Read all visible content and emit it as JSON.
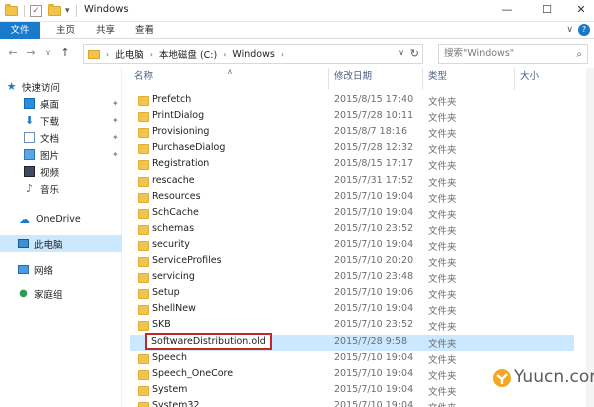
{
  "window": {
    "title": "Windows",
    "qa_dropdown": "▾",
    "controls": {
      "minimize": "—",
      "maximize": "☐",
      "close": "✕"
    }
  },
  "ribbon": {
    "tabs": [
      "文件",
      "主页",
      "共享",
      "查看"
    ],
    "expand": "∨",
    "help": "?",
    "file_color": "#1979ca"
  },
  "nav": {
    "back": "←",
    "forward": "→",
    "recent": "∨",
    "up": "↑",
    "breadcrumb": [
      "此电脑",
      "本地磁盘 (C:)",
      "Windows"
    ],
    "breadcrumb_sep": "›",
    "dropdown": "∨",
    "refresh": "↻",
    "search_placeholder": "搜索\"Windows\"",
    "search_icon": "⌕"
  },
  "sidebar": {
    "items": [
      {
        "label": "快速访问",
        "icon": "star-icon",
        "glyph": "★"
      },
      {
        "label": "桌面",
        "icon": "desktop-icon",
        "pinned": true
      },
      {
        "label": "下载",
        "icon": "download-icon",
        "pinned": true
      },
      {
        "label": "文档",
        "icon": "documents-icon",
        "pinned": true
      },
      {
        "label": "图片",
        "icon": "pictures-icon",
        "pinned": true
      },
      {
        "label": "视频",
        "icon": "videos-icon"
      },
      {
        "label": "音乐",
        "icon": "music-icon"
      },
      {
        "label": "OneDrive",
        "icon": "onedrive-icon"
      },
      {
        "label": "此电脑",
        "icon": "this-pc-icon",
        "selected": true
      },
      {
        "label": "网络",
        "icon": "network-icon"
      },
      {
        "label": "家庭组",
        "icon": "homegroup-icon"
      }
    ],
    "pin_glyph": "✦",
    "selected_color": "#cce8ff"
  },
  "columns": {
    "name": "名称",
    "date": "修改日期",
    "type": "类型",
    "size": "大小",
    "sort_indicator": "∧"
  },
  "files": [
    {
      "name": "Prefetch",
      "date": "2015/8/15 17:40",
      "type": "文件夹"
    },
    {
      "name": "PrintDialog",
      "date": "2015/7/28 10:11",
      "type": "文件夹"
    },
    {
      "name": "Provisioning",
      "date": "2015/8/7 18:16",
      "type": "文件夹"
    },
    {
      "name": "PurchaseDialog",
      "date": "2015/7/28 12:32",
      "type": "文件夹"
    },
    {
      "name": "Registration",
      "date": "2015/8/15 17:17",
      "type": "文件夹"
    },
    {
      "name": "rescache",
      "date": "2015/7/31 17:52",
      "type": "文件夹"
    },
    {
      "name": "Resources",
      "date": "2015/7/10 19:04",
      "type": "文件夹"
    },
    {
      "name": "SchCache",
      "date": "2015/7/10 19:04",
      "type": "文件夹"
    },
    {
      "name": "schemas",
      "date": "2015/7/10 23:52",
      "type": "文件夹"
    },
    {
      "name": "security",
      "date": "2015/7/10 19:04",
      "type": "文件夹"
    },
    {
      "name": "ServiceProfiles",
      "date": "2015/7/10 20:20",
      "type": "文件夹"
    },
    {
      "name": "servicing",
      "date": "2015/7/10 23:48",
      "type": "文件夹"
    },
    {
      "name": "Setup",
      "date": "2015/7/10 19:06",
      "type": "文件夹"
    },
    {
      "name": "ShellNew",
      "date": "2015/7/10 19:04",
      "type": "文件夹"
    },
    {
      "name": "SKB",
      "date": "2015/7/10 23:52",
      "type": "文件夹"
    },
    {
      "name": "SoftwareDistribution.old",
      "date": "2015/7/28 9:58",
      "type": "文件夹",
      "selected": true,
      "highlighted": true
    },
    {
      "name": "Speech",
      "date": "2015/7/10 19:04",
      "type": "文件夹"
    },
    {
      "name": "Speech_OneCore",
      "date": "2015/7/10 19:04",
      "type": "文件夹"
    },
    {
      "name": "System",
      "date": "2015/7/10 19:04",
      "type": "文件夹"
    },
    {
      "name": "System32",
      "date": "2015/7/10 19:04",
      "type": "文件夹"
    }
  ],
  "highlight_color": "#c4272a",
  "watermark": {
    "text": "Yuucn.com"
  }
}
